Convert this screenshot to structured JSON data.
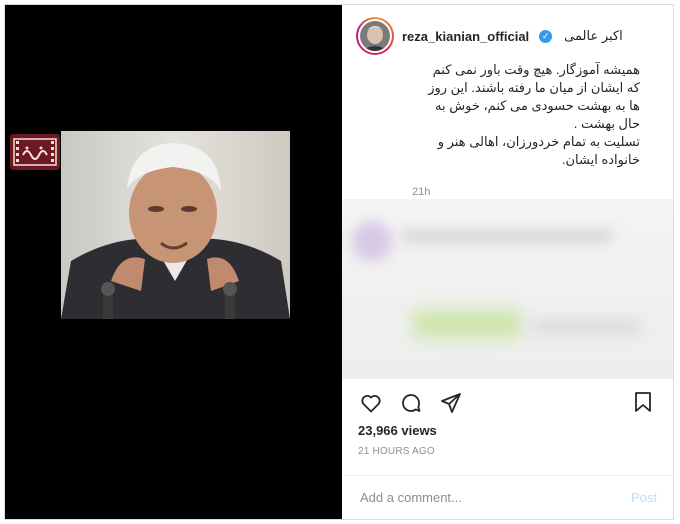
{
  "post": {
    "username": "reza_kianian_official",
    "location": "اکبر عالمی",
    "caption_lines": [
      "همیشه آموزگار. هیچ وقت باور نمی کنم",
      "که ایشان از میان ما رفته باشند. این روز",
      "ها به بهشت حسودی می کنم، خوش به",
      "حال بهشت .",
      "تسلیت به تمام خردورزان، اهالی هنر و",
      "خانواده ایشان."
    ],
    "caption_time": "21h",
    "views": "23,966 views",
    "time_ago": "21 HOURS AGO"
  },
  "comment": {
    "placeholder": "Add a comment...",
    "post_label": "Post"
  },
  "icons": {
    "like": "heart-icon",
    "comment": "comment-icon",
    "share": "share-icon",
    "save": "bookmark-icon",
    "verified": "verified-badge-icon"
  },
  "colors": {
    "accent": "#3897f0",
    "post_disabled": "#b2dffc",
    "muted": "#8e8e8e",
    "logo_bg": "#6e1727"
  }
}
